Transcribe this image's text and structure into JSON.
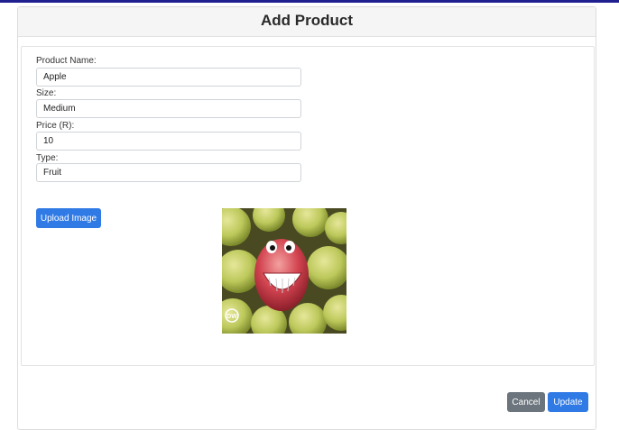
{
  "modal": {
    "title": "Add Product",
    "upload_label": "Upload Image",
    "cancel_label": "Cancel",
    "update_label": "Update"
  },
  "form": {
    "fields": [
      {
        "label": "Product Name:",
        "value": "Apple"
      },
      {
        "label": "Size:",
        "value": "Medium"
      },
      {
        "label": "Price (R):",
        "value": "10"
      },
      {
        "label": "Type:",
        "value": "Fruit"
      }
    ]
  },
  "colors": {
    "primary": "#2f7ae5",
    "secondary": "#6c757d",
    "topbar": "#1f1f8f"
  },
  "image": {
    "subject": "smiling apple among green apples",
    "watermark": "DW"
  }
}
